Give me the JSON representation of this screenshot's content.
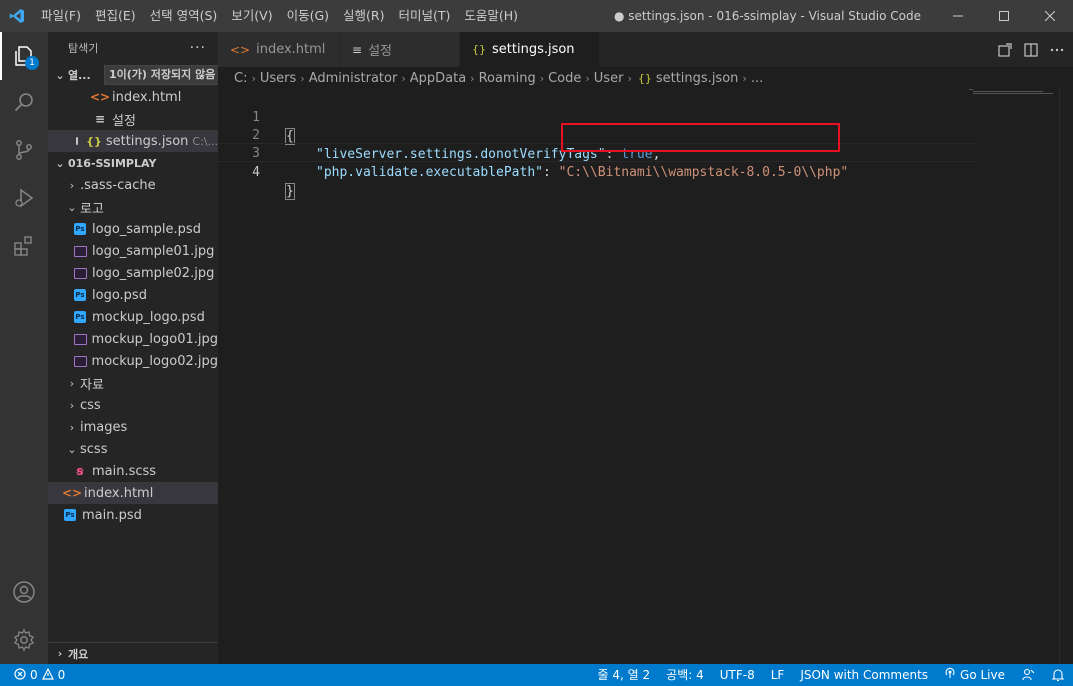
{
  "window": {
    "title": "● settings.json - 016-ssimplay - Visual Studio Code",
    "menu": [
      "파일(F)",
      "편집(E)",
      "선택 영역(S)",
      "보기(V)",
      "이동(G)",
      "실행(R)",
      "터미널(T)",
      "도움말(H)"
    ]
  },
  "activity": {
    "explorer_badge": "1"
  },
  "sidebar": {
    "title": "탐색기",
    "more": "···",
    "open_editors": {
      "label": "열...",
      "tooltip": "1이(가) 저장되지 않음",
      "items": [
        {
          "name": "index.html"
        },
        {
          "name": "설정"
        },
        {
          "name": "settings.json",
          "path": "C:\\..."
        }
      ]
    },
    "project": {
      "label": "016-SSIMPLAY",
      "items": [
        {
          "name": ".sass-cache",
          "kind": "folder",
          "open": false
        },
        {
          "name": "로고",
          "kind": "folder",
          "open": true
        },
        {
          "name": "logo_sample.psd",
          "kind": "psd"
        },
        {
          "name": "logo_sample01.jpg",
          "kind": "jpg"
        },
        {
          "name": "logo_sample02.jpg",
          "kind": "jpg"
        },
        {
          "name": "logo.psd",
          "kind": "psd"
        },
        {
          "name": "mockup_logo.psd",
          "kind": "psd"
        },
        {
          "name": "mockup_logo01.jpg",
          "kind": "jpg"
        },
        {
          "name": "mockup_logo02.jpg",
          "kind": "jpg"
        },
        {
          "name": "자료",
          "kind": "folder",
          "open": false
        },
        {
          "name": "css",
          "kind": "folder",
          "open": false
        },
        {
          "name": "images",
          "kind": "folder",
          "open": false
        },
        {
          "name": "scss",
          "kind": "folder",
          "open": true
        },
        {
          "name": "main.scss",
          "kind": "scss"
        },
        {
          "name": "index.html",
          "kind": "html"
        },
        {
          "name": "main.psd",
          "kind": "psd"
        }
      ]
    },
    "outline_label": "개요"
  },
  "tabs": [
    {
      "label": "index.html"
    },
    {
      "label": "설정"
    },
    {
      "label": "settings.json"
    }
  ],
  "breadcrumb": [
    "C:",
    "Users",
    "Administrator",
    "AppData",
    "Roaming",
    "Code",
    "User",
    "settings.json",
    "..."
  ],
  "editor": {
    "lines": [
      {
        "num": "1",
        "brace": "{"
      },
      {
        "num": "2",
        "key": "\"liveServer.settings.donotVerifyTags\"",
        "colon": ": ",
        "value": "true",
        "comma": ","
      },
      {
        "num": "3",
        "key": "\"php.validate.executablePath\"",
        "colon": ": ",
        "quote": "\"",
        "value": "C:\\\\Bitnami\\\\wampstack-8.0.5-0\\\\php",
        "endquote": "\""
      },
      {
        "num": "4",
        "brace": "}"
      }
    ]
  },
  "status": {
    "errors": "0",
    "warnings": "0",
    "position": "줄 4, 열 2",
    "spaces": "공백: 4",
    "encoding": "UTF-8",
    "eol": "LF",
    "language": "JSON with Comments",
    "golive": "Go Live"
  }
}
